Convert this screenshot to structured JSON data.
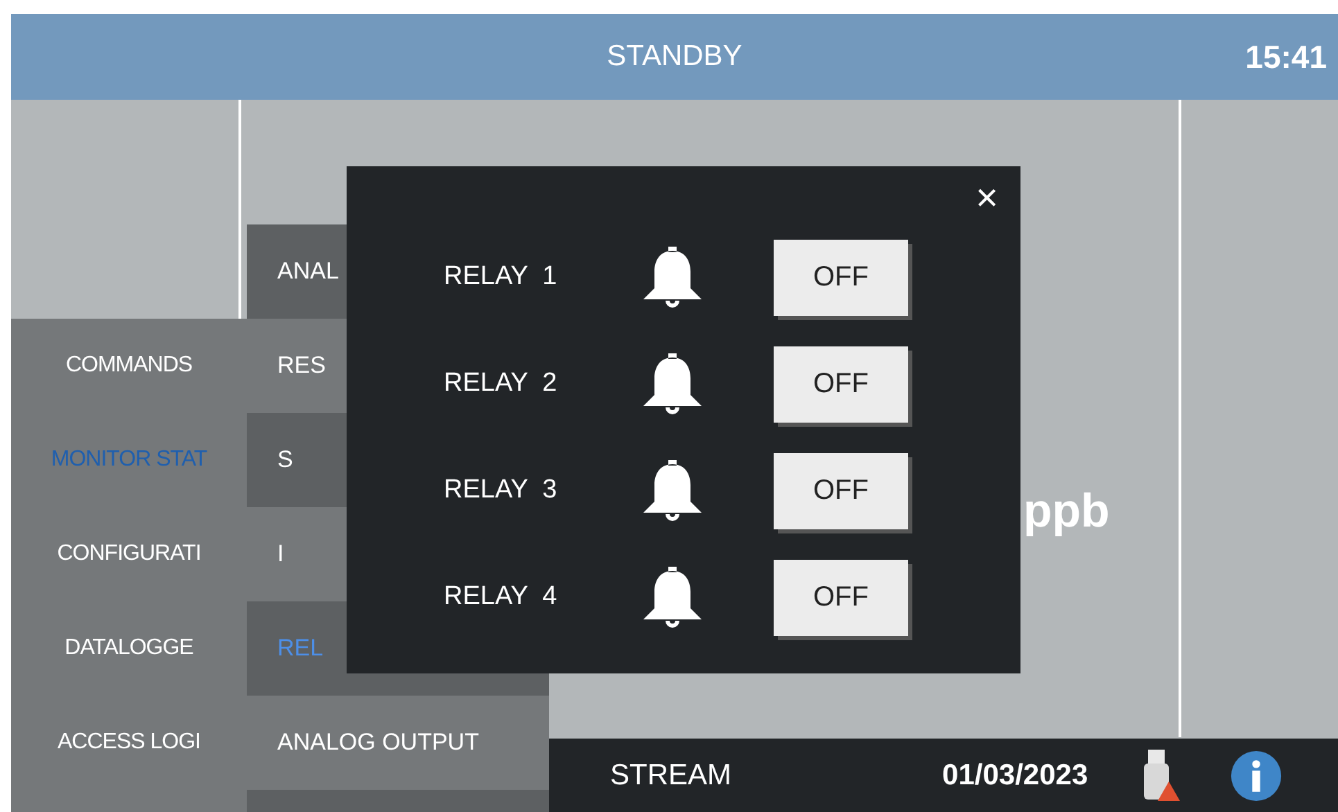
{
  "header": {
    "title": "STANDBY",
    "time": "15:41"
  },
  "menu": [
    {
      "label": "COMMANDS",
      "selected": false
    },
    {
      "label": "MONITOR STAT",
      "selected": true
    },
    {
      "label": "CONFIGURATI",
      "selected": false
    },
    {
      "label": "DATALOGGE",
      "selected": false
    },
    {
      "label": "ACCESS LOGI",
      "selected": false
    }
  ],
  "submenu": [
    {
      "label": "ANAL",
      "selected": false
    },
    {
      "label": "RES",
      "selected": false
    },
    {
      "label": "S",
      "selected": false
    },
    {
      "label": "I",
      "selected": false
    },
    {
      "label": "REL",
      "selected": true
    },
    {
      "label": "ANALOG OUTPUT",
      "selected": false
    }
  ],
  "unit": "ppb",
  "relay_dialog": {
    "close": "×",
    "relays": [
      {
        "label": "RELAY  1",
        "button": "OFF"
      },
      {
        "label": "RELAY  2",
        "button": "OFF"
      },
      {
        "label": "RELAY  3",
        "button": "OFF"
      },
      {
        "label": "RELAY  4",
        "button": "OFF"
      }
    ]
  },
  "status_bar": {
    "stream": "STREAM",
    "date": "01/03/2023"
  }
}
